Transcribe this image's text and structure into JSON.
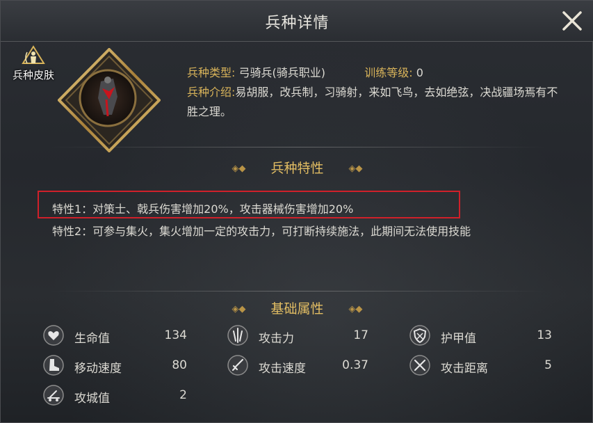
{
  "header": {
    "title": "兵种详情",
    "close_icon": "close-icon"
  },
  "skin_button": {
    "label": "兵种皮肤",
    "icon": "archer-silhouette-icon"
  },
  "portrait": {
    "icon": "cavalry-archer-portrait"
  },
  "info": {
    "type_key": "兵种类型:",
    "type_value": "弓骑兵(骑兵职业)",
    "training_key": "训练等级:",
    "training_value": "0",
    "intro_key": "兵种介绍:",
    "intro_value": "易胡服，改兵制，习骑射，来如飞鸟，去如绝弦，决战疆场焉有不胜之理。"
  },
  "traits": {
    "section_title": "兵种特性",
    "items": [
      "特性1：对策士、戟兵伤害增加20%，攻击器械伤害增加20%",
      "特性2：可参与集火，集火增加一定的攻击力，可打断持续施法，此期间无法使用技能"
    ]
  },
  "attributes": {
    "section_title": "基础属性",
    "items": [
      {
        "label": "生命值",
        "value": "134",
        "icon": "heart-icon"
      },
      {
        "label": "攻击力",
        "value": "17",
        "icon": "attack-power-icon"
      },
      {
        "label": "护甲值",
        "value": "13",
        "icon": "shield-icon"
      },
      {
        "label": "移动速度",
        "value": "80",
        "icon": "boot-icon"
      },
      {
        "label": "攻击速度",
        "value": "0.37",
        "icon": "sword-icon"
      },
      {
        "label": "攻击距离",
        "value": "5",
        "icon": "crossed-swords-icon"
      },
      {
        "label": "攻城值",
        "value": "2",
        "icon": "siege-catapult-icon"
      }
    ]
  },
  "colors": {
    "accent_gold": "#e2bd63",
    "highlight_red": "#d0202a"
  }
}
